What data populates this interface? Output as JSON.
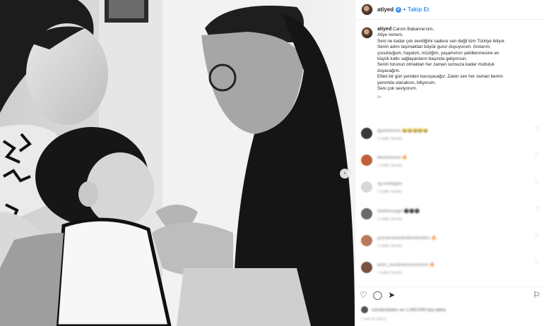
{
  "post": {
    "username": "atiyed",
    "verified_mark": "✔",
    "separator": "•",
    "follow_label": "Takip Et",
    "image_description_icon": "photo-collage",
    "next_icon": "›"
  },
  "caption": {
    "username": "atiyed",
    "lines": [
      "Canım Babanne'cim,",
      "Atiye nenem,",
      "Seni ne kadar çok sevdiğimi sadece sen değil tüm Türkiye biliyor.",
      "Senin adını taşımaktan büyük gurur duyuyorum. Anılarım,",
      "çocukluğum, hayatım, müziğim, yaşamımın şekillenmesine en",
      "büyük katkı sağlayanların başında geliyorsun.",
      "Senin torunun olmaktan her zaman sonsuza kadar mutluluk",
      "duyacağım.",
      "Elbet bir gün yeniden kavuşacağız. Zaten sen her zaman benim",
      "yanımda olacaksın, biliyorum.",
      "Seni çok seviyorum."
    ],
    "time": "8s"
  },
  "comments": [
    {
      "text": "djoshstosms 😂😂😂😂😂",
      "meta": "1 hafta   Yanıtla",
      "avatar_color": "#3a3a3a"
    },
    {
      "text": "leesmmsrsts 🔥",
      "meta": "1 hafta   Yanıtla",
      "avatar_color": "#c0603a"
    },
    {
      "text": "sg.osshatgns",
      "meta": "1 hafta   Yanıtla",
      "avatar_color": "#d8d8d8"
    },
    {
      "text": "mlshrlnsurgtn ⚫⚫⚫",
      "meta": "1 hafta   Yanıtla",
      "avatar_color": "#6a6a6a"
    },
    {
      "text": "prosserststsnts/ldsnldsntlsrs 🔥",
      "meta": "1 hafta   Yanıtla",
      "avatar_color": "#b87a5a"
    },
    {
      "text": "aslzs_bsnsbolsmsnsssstrst 🔥",
      "meta": "1 hafta   Yanıtla",
      "avatar_color": "#7a5040"
    }
  ],
  "actions": {
    "like_icon": "♡",
    "comment_icon": "◯",
    "share_icon": "➤",
    "save_icon": "⚐"
  },
  "likes": {
    "text": "ssnsbssbdsn ve 1.000.000 kişi daha"
  },
  "post_time": "1 HAFTA ÖNCE",
  "colors": {
    "accent": "#3897f0",
    "text": "#262626",
    "muted": "#999999",
    "border": "#efefef"
  }
}
